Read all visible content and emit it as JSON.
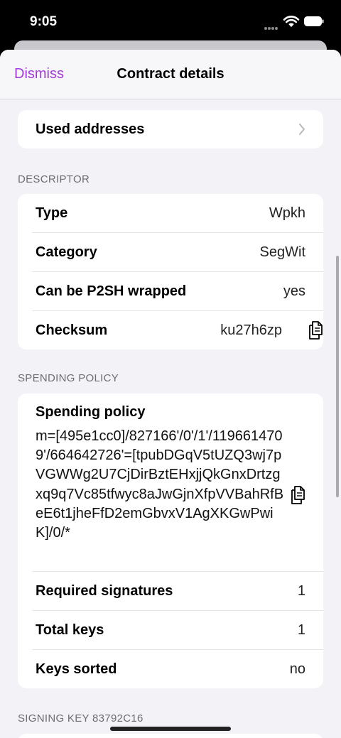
{
  "status_bar": {
    "time": "9:05"
  },
  "nav": {
    "dismiss_label": "Dismiss",
    "title": "Contract details"
  },
  "used_addresses": {
    "label": "Used addresses"
  },
  "descriptor": {
    "header": "DESCRIPTOR",
    "rows": [
      {
        "label": "Type",
        "value": "Wpkh"
      },
      {
        "label": "Category",
        "value": "SegWit"
      },
      {
        "label": "Can be P2SH wrapped",
        "value": "yes"
      },
      {
        "label": "Checksum",
        "value": "ku27h6zp"
      }
    ]
  },
  "spending_policy": {
    "header": "SPENDING POLICY",
    "title": "Spending policy",
    "text": "m=[495e1cc0]/827166'/0'/1'/1196614709'/664642726'=[tpubDGqV5tUZQ3wj7pVGWWg2U7CjDirBztEHxjjQkGnxDrtzgxq9q7Vc85tfwyc8aJwGjnXfpVVBahRfBeE6t1jheFfD2emGbvxV1AgXKGwPwiK]/0/*",
    "rows": [
      {
        "label": "Required signatures",
        "value": "1"
      },
      {
        "label": "Total keys",
        "value": "1"
      },
      {
        "label": "Keys sorted",
        "value": "no"
      }
    ]
  },
  "signing_key": {
    "header": "SIGNING KEY 83792C16"
  }
}
